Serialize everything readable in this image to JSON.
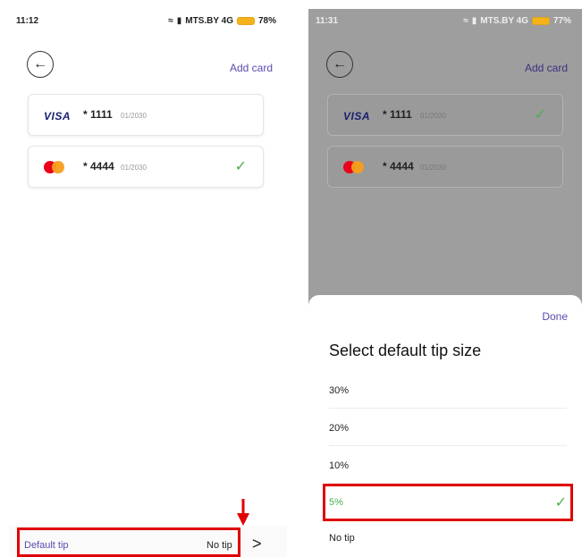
{
  "left": {
    "statusbar": {
      "time": "11:12",
      "network": "MTS.BY 4G",
      "battery": "78%"
    },
    "header": {
      "add_card_label": "Add card"
    },
    "cards": [
      {
        "brand": "VISA",
        "number": "* 1111",
        "expiry": "01/2030",
        "selected": false
      },
      {
        "brand": "mastercard",
        "number": "* 4444",
        "expiry": "01/2030",
        "selected": true
      }
    ],
    "default_tip": {
      "label": "Default tip",
      "value": "No tip",
      "chevron": ">"
    }
  },
  "right": {
    "statusbar": {
      "time": "11:31",
      "network": "MTS.BY 4G",
      "battery": "77%"
    },
    "header": {
      "add_card_label": "Add card"
    },
    "cards": [
      {
        "brand": "VISA",
        "number": "* 1111",
        "expiry": "01/2030",
        "selected": true
      },
      {
        "brand": "mastercard",
        "number": "* 4444",
        "expiry": "01/2030",
        "selected": false
      }
    ],
    "sheet": {
      "done_label": "Done",
      "title": "Select default tip size",
      "options": [
        {
          "label": "30%",
          "selected": false
        },
        {
          "label": "20%",
          "selected": false
        },
        {
          "label": "10%",
          "selected": false
        },
        {
          "label": "5%",
          "selected": true
        },
        {
          "label": "No tip",
          "selected": false
        }
      ]
    }
  },
  "icons": {
    "back": "arrow-left-icon",
    "check": "checkmark-icon",
    "chevron": "chevron-right-icon",
    "wifi": "wifi-icon",
    "signal": "signal-icon",
    "battery": "battery-icon"
  },
  "colors": {
    "accent": "#5b4bb0",
    "check": "#4caf50",
    "highlight": "#e00000",
    "overlay": "#9e9e9e",
    "battery": "#f5b319"
  }
}
